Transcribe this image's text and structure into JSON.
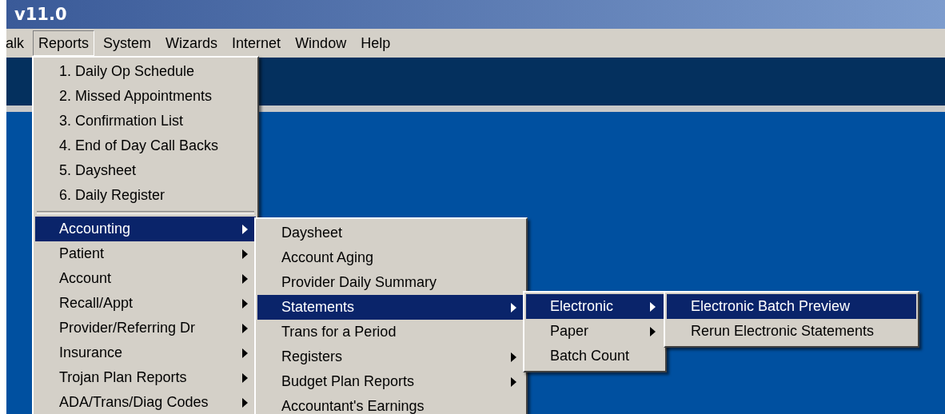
{
  "window": {
    "title": "v11.0"
  },
  "menubar": [
    {
      "label": "alk",
      "selected": false
    },
    {
      "label": "Reports",
      "selected": true
    },
    {
      "label": "System",
      "selected": false
    },
    {
      "label": "Wizards",
      "selected": false
    },
    {
      "label": "Internet",
      "selected": false
    },
    {
      "label": "Window",
      "selected": false
    },
    {
      "label": "Help",
      "selected": false
    }
  ],
  "menus": [
    {
      "items": [
        {
          "kind": "item",
          "label": "1. Daily Op Schedule",
          "submenu": false,
          "selected": false
        },
        {
          "kind": "item",
          "label": "2. Missed Appointments",
          "submenu": false,
          "selected": false
        },
        {
          "kind": "item",
          "label": "3. Confirmation List",
          "submenu": false,
          "selected": false
        },
        {
          "kind": "item",
          "label": "4. End of Day Call Backs",
          "submenu": false,
          "selected": false
        },
        {
          "kind": "item",
          "label": "5. Daysheet",
          "submenu": false,
          "selected": false
        },
        {
          "kind": "item",
          "label": "6. Daily Register",
          "submenu": false,
          "selected": false
        },
        {
          "kind": "separator"
        },
        {
          "kind": "item",
          "label": "Accounting",
          "submenu": true,
          "selected": true
        },
        {
          "kind": "item",
          "label": "Patient",
          "submenu": true,
          "selected": false
        },
        {
          "kind": "item",
          "label": "Account",
          "submenu": true,
          "selected": false
        },
        {
          "kind": "item",
          "label": "Recall/Appt",
          "submenu": true,
          "selected": false
        },
        {
          "kind": "item",
          "label": "Provider/Referring Dr",
          "submenu": true,
          "selected": false
        },
        {
          "kind": "item",
          "label": "Insurance",
          "submenu": true,
          "selected": false
        },
        {
          "kind": "item",
          "label": "Trojan Plan Reports",
          "submenu": true,
          "selected": false
        },
        {
          "kind": "item",
          "label": "ADA/Trans/Diag Codes",
          "submenu": true,
          "selected": false
        }
      ]
    },
    {
      "items": [
        {
          "kind": "item",
          "label": "Daysheet",
          "submenu": false,
          "selected": false
        },
        {
          "kind": "item",
          "label": "Account Aging",
          "submenu": false,
          "selected": false
        },
        {
          "kind": "item",
          "label": "Provider Daily Summary",
          "submenu": false,
          "selected": false
        },
        {
          "kind": "item",
          "label": "Statements",
          "submenu": true,
          "selected": true
        },
        {
          "kind": "item",
          "label": "Trans for a Period",
          "submenu": false,
          "selected": false
        },
        {
          "kind": "item",
          "label": "Registers",
          "submenu": true,
          "selected": false
        },
        {
          "kind": "item",
          "label": "Budget Plan Reports",
          "submenu": true,
          "selected": false
        },
        {
          "kind": "item",
          "label": "Accountant's Earnings",
          "submenu": false,
          "selected": false
        }
      ]
    },
    {
      "items": [
        {
          "kind": "item",
          "label": "Electronic",
          "submenu": true,
          "selected": true
        },
        {
          "kind": "item",
          "label": "Paper",
          "submenu": true,
          "selected": false
        },
        {
          "kind": "item",
          "label": "Batch Count",
          "submenu": false,
          "selected": false
        }
      ]
    },
    {
      "items": [
        {
          "kind": "item",
          "label": "Electronic Batch Preview",
          "submenu": false,
          "selected": true
        },
        {
          "kind": "item",
          "label": "Rerun Electronic Statements",
          "submenu": false,
          "selected": false
        }
      ]
    }
  ]
}
